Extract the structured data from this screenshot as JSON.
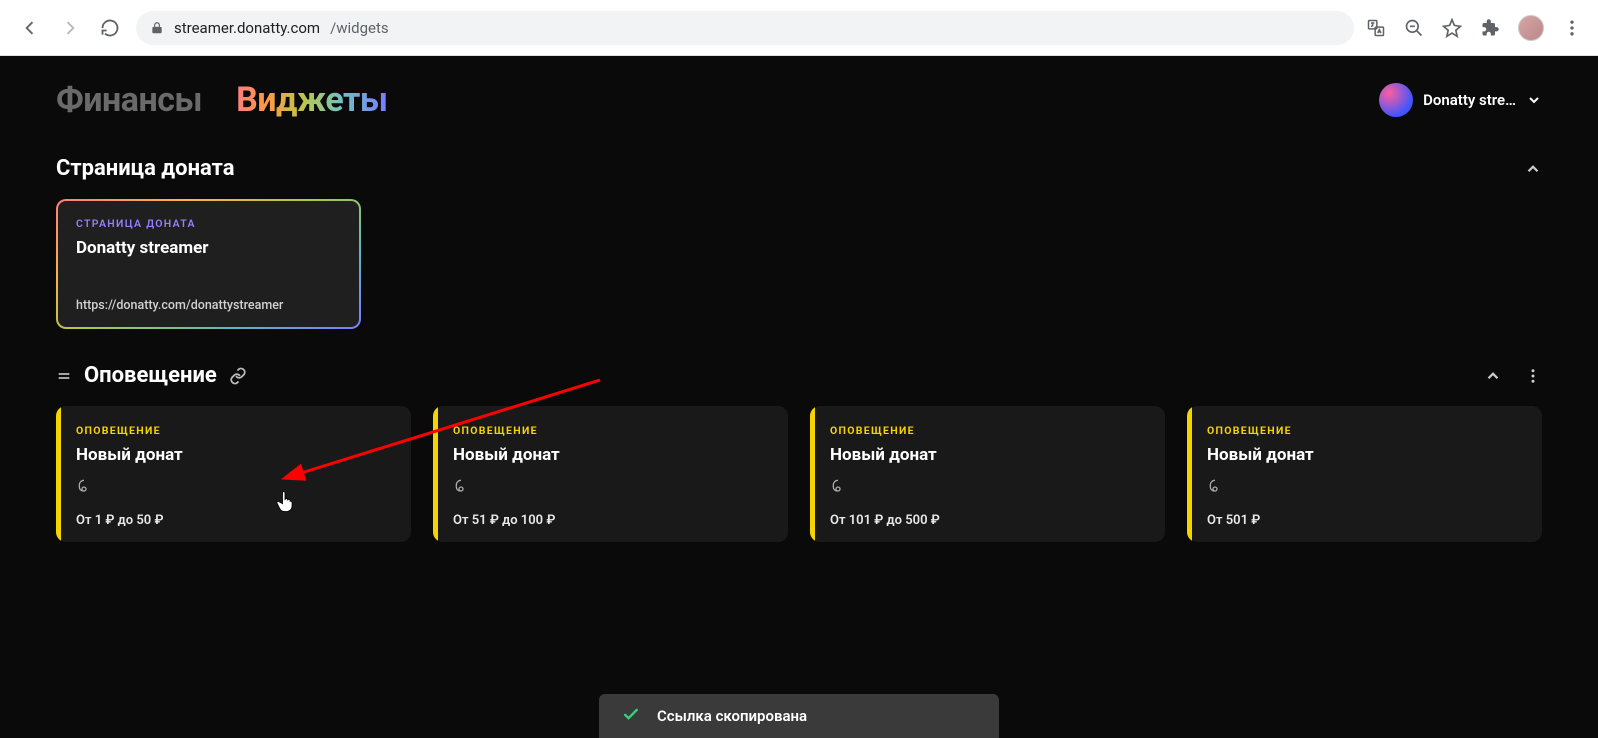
{
  "browser": {
    "url_host": "streamer.donatty.com",
    "url_path": "/widgets"
  },
  "nav": {
    "tab_finances": "Финансы",
    "tab_widgets": "Виджеты"
  },
  "user": {
    "display_name": "Donatty stre…"
  },
  "donation_section": {
    "title": "Страница доната",
    "card": {
      "eyebrow": "СТРАНИЦА ДОНАТА",
      "title": "Donatty streamer",
      "url": "https://donatty.com/donattystreamer"
    }
  },
  "alert_section": {
    "title": "Оповещение",
    "eyebrow": "ОПОВЕЩЕНИЕ",
    "card_title": "Новый донат",
    "cards": [
      {
        "range": "От 1 ₽ до 50 ₽"
      },
      {
        "range": "От 51 ₽ до 100 ₽"
      },
      {
        "range": "От 101 ₽ до 500 ₽"
      },
      {
        "range": "От 501 ₽"
      }
    ]
  },
  "toast": {
    "message": "Ссылка скопирована"
  }
}
